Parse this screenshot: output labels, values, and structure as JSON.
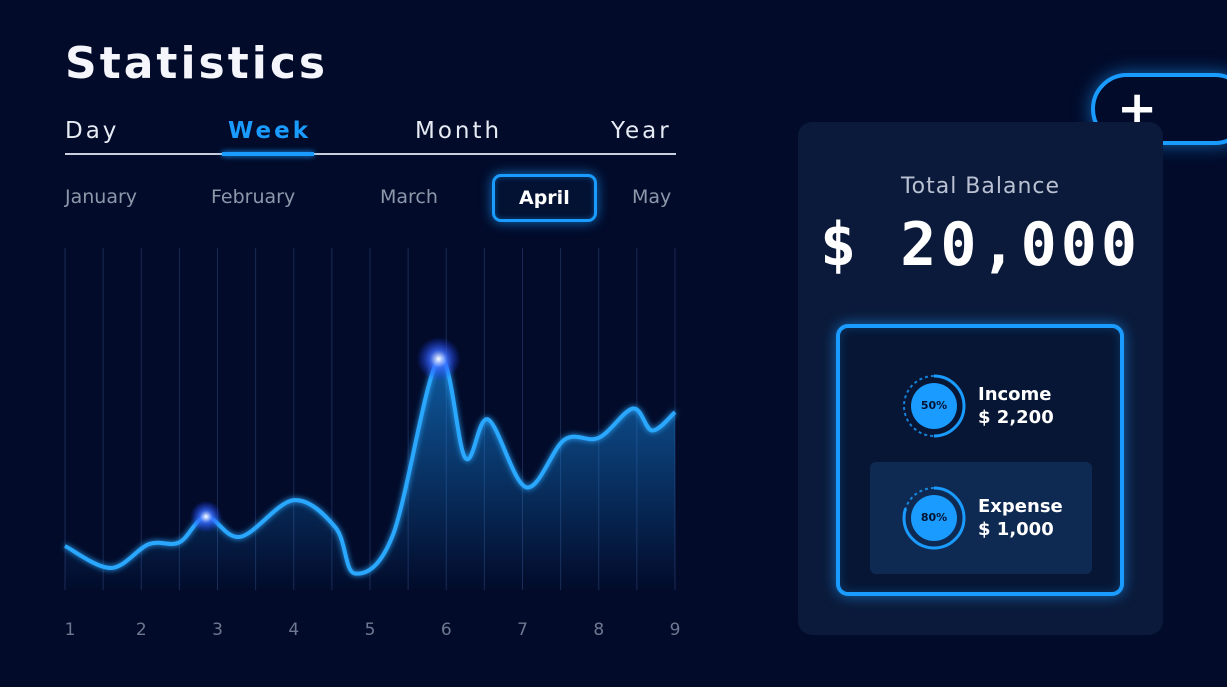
{
  "page": {
    "title": "Statistics"
  },
  "tabs": [
    {
      "label": "Day",
      "active": false
    },
    {
      "label": "Week",
      "active": true
    },
    {
      "label": "Month",
      "active": false
    },
    {
      "label": "Year",
      "active": false
    }
  ],
  "months": [
    {
      "label": "January",
      "active": false
    },
    {
      "label": "February",
      "active": false
    },
    {
      "label": "March",
      "active": false
    },
    {
      "label": "April",
      "active": true
    },
    {
      "label": "May",
      "active": false
    }
  ],
  "colors": {
    "accent": "#1a9bff",
    "background": "#020b2a",
    "card": "#0b1a3a"
  },
  "chart_data": {
    "type": "area",
    "x": [
      1,
      2,
      3,
      4,
      5,
      6,
      7,
      8,
      9
    ],
    "categories": [
      "1",
      "2",
      "3",
      "4",
      "5",
      "6",
      "7",
      "8",
      "9"
    ],
    "points": [
      {
        "x": 1.0,
        "y": 1.2
      },
      {
        "x": 1.6,
        "y": 0.6
      },
      {
        "x": 2.1,
        "y": 1.25
      },
      {
        "x": 2.5,
        "y": 1.3
      },
      {
        "x": 2.85,
        "y": 2.0
      },
      {
        "x": 3.3,
        "y": 1.45
      },
      {
        "x": 4.0,
        "y": 2.45
      },
      {
        "x": 4.55,
        "y": 1.7
      },
      {
        "x": 4.8,
        "y": 0.45
      },
      {
        "x": 5.3,
        "y": 1.5
      },
      {
        "x": 5.9,
        "y": 6.3
      },
      {
        "x": 6.25,
        "y": 3.6
      },
      {
        "x": 6.55,
        "y": 4.65
      },
      {
        "x": 7.05,
        "y": 2.8
      },
      {
        "x": 7.55,
        "y": 4.1
      },
      {
        "x": 8.0,
        "y": 4.15
      },
      {
        "x": 8.45,
        "y": 4.95
      },
      {
        "x": 8.7,
        "y": 4.35
      },
      {
        "x": 9.0,
        "y": 4.85
      }
    ],
    "highlights": [
      2.85,
      5.9
    ],
    "ylim": [
      0,
      9
    ],
    "xlim": [
      1,
      9
    ],
    "grid": "vertical"
  },
  "balance": {
    "label": "Total Balance",
    "value": "$ 20,000"
  },
  "plus_button": {
    "icon": "plus-icon",
    "glyph": "+"
  },
  "income": {
    "label": "Income",
    "amount": "$ 2,200",
    "percent_text": "50%",
    "percent": 0.5
  },
  "expense": {
    "label": "Expense",
    "amount": "$ 1,000",
    "percent_text": "80%",
    "percent": 0.8
  }
}
